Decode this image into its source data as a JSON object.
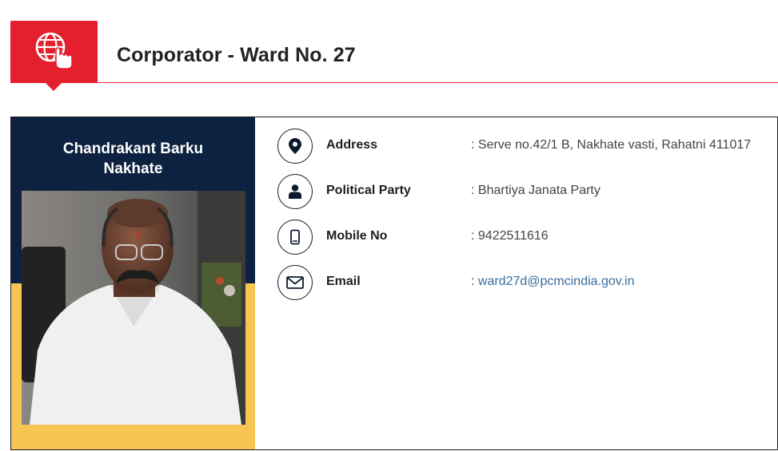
{
  "header": {
    "title": "Corporator - Ward No. 27",
    "icon": "globe-pointer-icon",
    "accent_color": "#e5202e"
  },
  "profile": {
    "name_line1": "Chandrakant Barku",
    "name_line2": "Nakhate",
    "photo_desc": "corporator-portrait",
    "panel_top_color": "#0d2240",
    "panel_bottom_color": "#f6c552"
  },
  "details": [
    {
      "icon": "location-pin-icon",
      "label": "Address",
      "value": ": Serve no.42/1 B, Nakhate vasti, Rahatni 411017"
    },
    {
      "icon": "person-icon",
      "label": "Political Party",
      "value": ": Bhartiya Janata Party"
    },
    {
      "icon": "mobile-phone-icon",
      "label": "Mobile No",
      "value": ": 9422511616"
    },
    {
      "icon": "envelope-icon",
      "label": "Email",
      "value_prefix": ": ",
      "value_link": "ward27d@pcmcindia.gov.in"
    }
  ]
}
